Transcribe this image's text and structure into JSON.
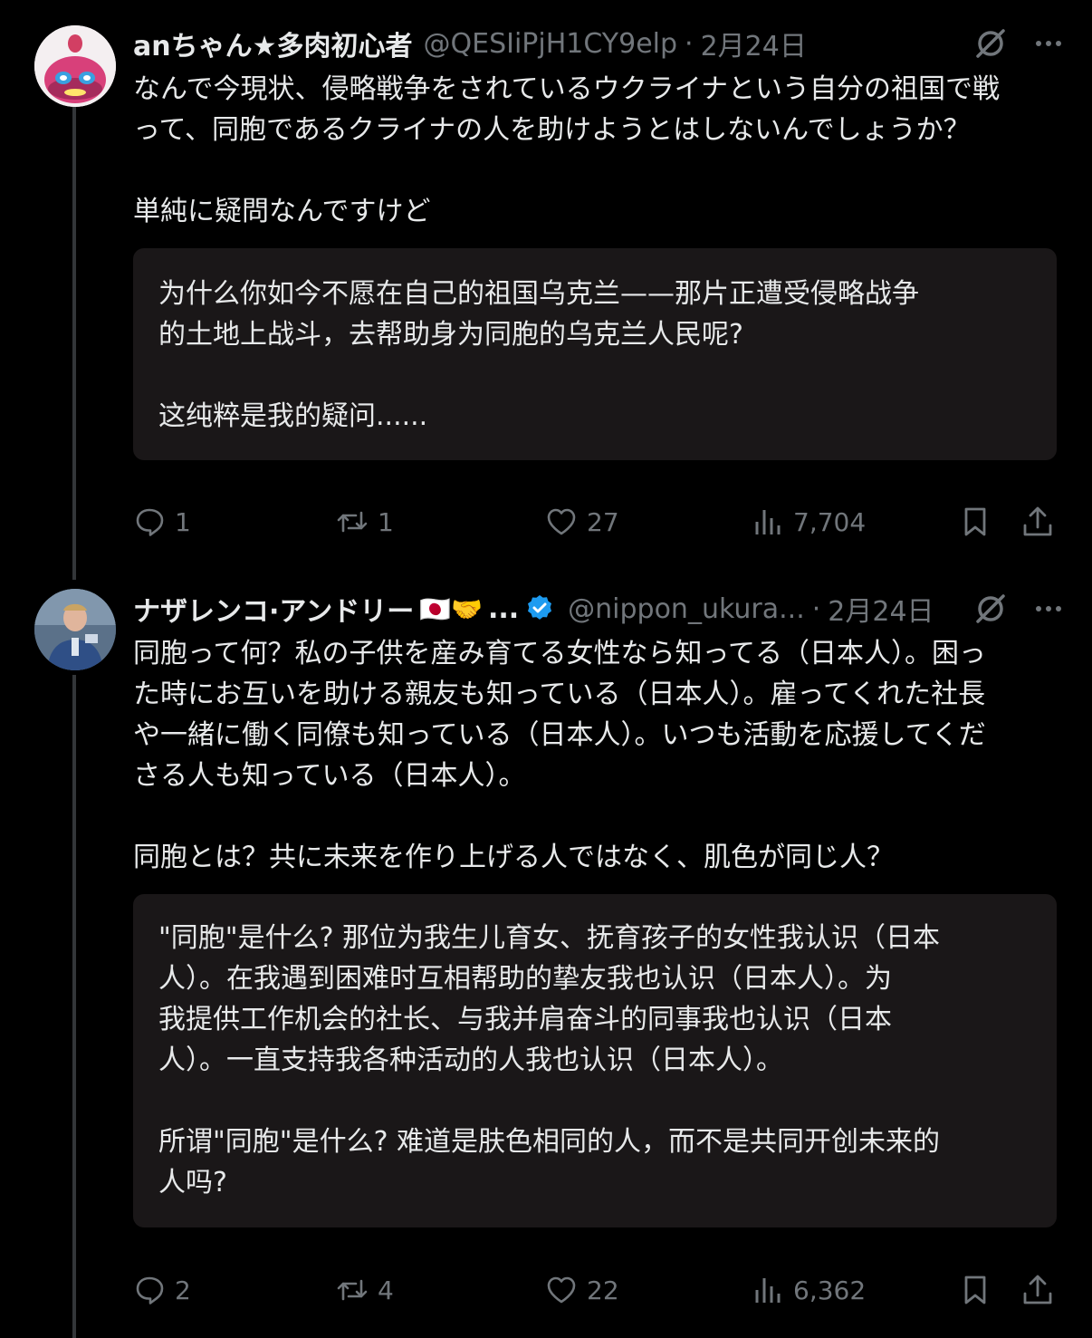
{
  "tweets": [
    {
      "author": {
        "display_name": "anちゃん★多肉初心者",
        "handle": "@QESIiPjH1CY9elp",
        "separator": "·",
        "date": "2月24日"
      },
      "text_lines": [
        "なんで今現状、侵略戦争をされているウクライナという自分の祖国で戦",
        "って、同胞であるクライナの人を助けようとはしないんでしょうか？",
        "",
        "単純に疑問なんですけど"
      ],
      "translation_lines": [
        "为什么你如今不愿在自己的祖国乌克兰——那片正遭受侵略战争",
        "的土地上战斗，去帮助身为同胞的乌克兰人民呢?",
        "",
        "这纯粹是我的疑问......"
      ],
      "stats": {
        "replies": "1",
        "reposts": "1",
        "likes": "27",
        "views": "7,704"
      }
    },
    {
      "author": {
        "display_name": "ナザレンコ·アンドリー",
        "emojis": "🇯🇵🤝",
        "ellipsis": "...",
        "handle": "@nippon_ukura...",
        "separator": "·",
        "date": "2月24日"
      },
      "text_lines": [
        "同胞って何？私の子供を産み育てる女性なら知ってる（日本人）。困っ",
        "た時にお互いを助ける親友も知っている（日本人）。雇ってくれた社長",
        "や一緒に働く同僚も知っている（日本人）。いつも活動を応援してくだ",
        "さる人も知っている（日本人）。",
        "",
        "同胞とは？共に未来を作り上げる人ではなく、肌色が同じ人？"
      ],
      "translation_lines": [
        "\"同胞\"是什么? 那位为我生儿育女、抚育孩子的女性我认识（日本",
        "人）。在我遇到困难时互相帮助的挚友我也认识（日本人）。为",
        "我提供工作机会的社长、与我并肩奋斗的同事我也认识（日本",
        "人）。一直支持我各种活动的人我也认识（日本人）。",
        "",
        "所谓\"同胞\"是什么? 难道是肤色相同的人，而不是共同开创未来的",
        "人吗?"
      ],
      "stats": {
        "replies": "2",
        "reposts": "4",
        "likes": "22",
        "views": "6,362"
      }
    }
  ],
  "icons": {
    "reply": "reply-icon",
    "repost": "repost-icon",
    "like": "heart-icon",
    "views": "views-icon",
    "bookmark": "bookmark-icon",
    "share": "share-icon",
    "grok": "grok-icon",
    "more": "more-icon",
    "verified": "verified-badge-icon"
  },
  "colors": {
    "background": "#000000",
    "text": "#e7e9ea",
    "muted": "#71767b",
    "translation_bg": "#1a1718",
    "thread_line": "#333639",
    "verified": "#1d9bf0"
  }
}
